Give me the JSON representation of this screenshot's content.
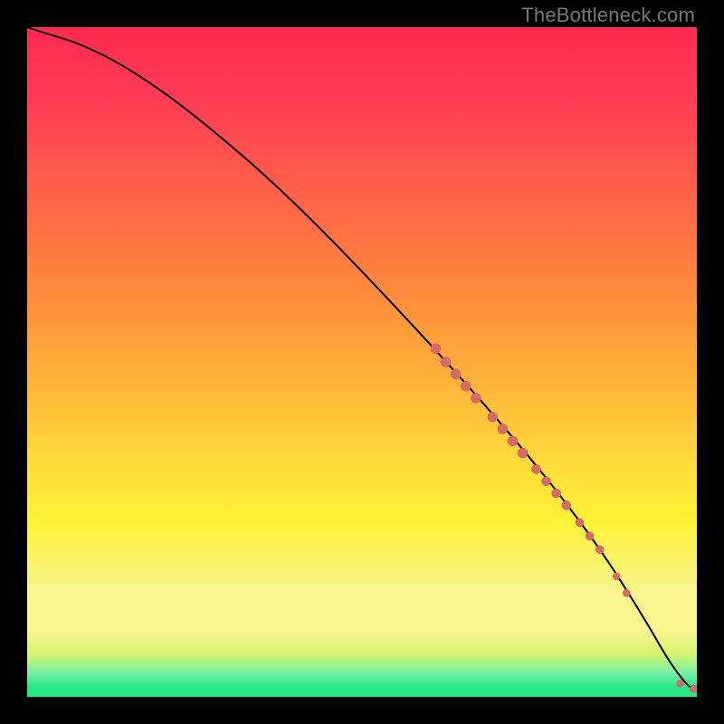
{
  "watermark": "TheBottleneck.com",
  "colors": {
    "frame": "#000000",
    "curve": "#000000",
    "marker_fill": "#d86a6a",
    "marker_stroke": "#c25a5a",
    "green": "#27e884",
    "green_light": "#75f0aa",
    "yellow_green": "#d9f56a",
    "yellow_pale": "#f7f58e",
    "yellow": "#fff236",
    "yellow_orange": "#ffd83a",
    "orange": "#ffb03a",
    "orange_deep": "#ff8b3c",
    "orange_red": "#ff6a45",
    "red": "#ff3a55",
    "red_top": "#ff2a50"
  },
  "chart_data": {
    "type": "line",
    "title": "",
    "xlabel": "",
    "ylabel": "",
    "xlim": [
      0,
      100
    ],
    "ylim": [
      0,
      100
    ],
    "curve": {
      "x": [
        0,
        3,
        8,
        15,
        25,
        40,
        60,
        75,
        85,
        92,
        96,
        99,
        100
      ],
      "y": [
        100,
        99,
        97.5,
        94,
        87,
        74,
        53,
        36,
        23,
        12,
        5,
        1.2,
        1.2
      ]
    },
    "markers": [
      {
        "x": 61,
        "y": 52,
        "r": 5.5
      },
      {
        "x": 62.5,
        "y": 50,
        "r": 5.5
      },
      {
        "x": 64,
        "y": 48.2,
        "r": 5.5
      },
      {
        "x": 65.5,
        "y": 46.4,
        "r": 5.5
      },
      {
        "x": 67,
        "y": 44.6,
        "r": 5.5
      },
      {
        "x": 69.5,
        "y": 41.8,
        "r": 5.5
      },
      {
        "x": 71,
        "y": 40,
        "r": 5.5
      },
      {
        "x": 72.5,
        "y": 38.2,
        "r": 5.5
      },
      {
        "x": 74,
        "y": 36.4,
        "r": 5.5
      },
      {
        "x": 76,
        "y": 34,
        "r": 5
      },
      {
        "x": 77.5,
        "y": 32.2,
        "r": 5
      },
      {
        "x": 79,
        "y": 30.4,
        "r": 5
      },
      {
        "x": 80.5,
        "y": 28.6,
        "r": 5
      },
      {
        "x": 82.5,
        "y": 26,
        "r": 4.5
      },
      {
        "x": 84,
        "y": 24,
        "r": 4.5
      },
      {
        "x": 85.5,
        "y": 22,
        "r": 4.5
      },
      {
        "x": 88,
        "y": 18,
        "r": 4
      },
      {
        "x": 89.5,
        "y": 15.5,
        "r": 4
      },
      {
        "x": 97.5,
        "y": 2,
        "r": 4
      },
      {
        "x": 99.5,
        "y": 1.2,
        "r": 4
      },
      {
        "x": 100.3,
        "y": 1.2,
        "r": 4
      }
    ]
  }
}
